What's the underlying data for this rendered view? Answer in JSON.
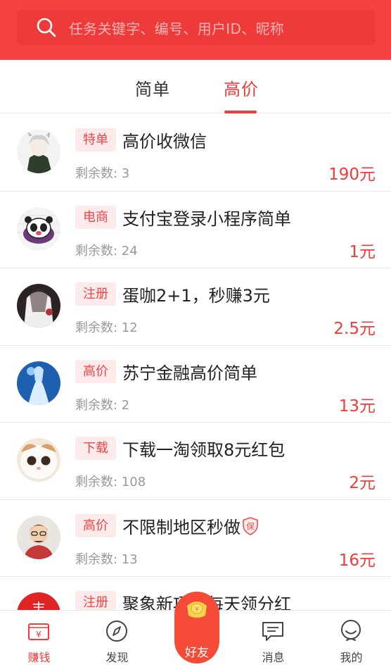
{
  "search": {
    "placeholder": "任务关键字、编号、用户ID、昵称"
  },
  "tabs": [
    {
      "label": "简单",
      "active": false
    },
    {
      "label": "高价",
      "active": true
    }
  ],
  "tasks": [
    {
      "tag": "特单",
      "title": "高价收微信",
      "remain": "剩余数: 3",
      "price": "190元"
    },
    {
      "tag": "电商",
      "title": "支付宝登录小程序简单",
      "remain": "剩余数: 24",
      "price": "1元"
    },
    {
      "tag": "注册",
      "title": "蛋咖2+1，秒赚3元",
      "remain": "剩余数: 12",
      "price": "2.5元"
    },
    {
      "tag": "高价",
      "title": "苏宁金融高价简单",
      "remain": "剩余数: 2",
      "price": "13元"
    },
    {
      "tag": "下载",
      "title": "下载一淘领取8元红包",
      "remain": "剩余数: 108",
      "price": "2元"
    },
    {
      "tag": "高价",
      "title": "不限制地区秒做",
      "remain": "剩余数: 13",
      "price": "16元",
      "badge": "保"
    },
    {
      "tag": "注册",
      "title": "聚象新项目每天领分红",
      "remain": "",
      "price": ""
    }
  ],
  "tabbar": [
    {
      "label": "赚钱",
      "icon": "wallet-icon",
      "active": true
    },
    {
      "label": "发现",
      "icon": "compass-icon",
      "active": false
    },
    {
      "label": "好友",
      "icon": "coin-icon",
      "active": false
    },
    {
      "label": "消息",
      "icon": "message-icon",
      "active": false
    },
    {
      "label": "我的",
      "icon": "user-icon",
      "active": false
    }
  ],
  "colors": {
    "brand": "#f44242",
    "accent": "#f23b3b",
    "tag_bg": "#fdeaea"
  }
}
